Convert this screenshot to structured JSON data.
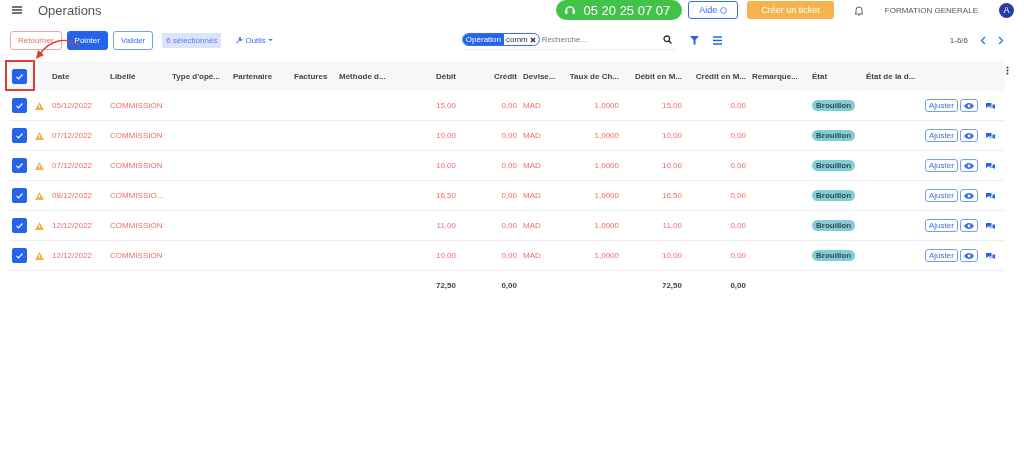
{
  "header": {
    "title": "Operations",
    "phone": "05 20 25 07 07",
    "help": "Aide",
    "ticket": "Créer un ticket",
    "company": "FORMATION GENERALE",
    "avatar": "A"
  },
  "toolbar": {
    "buttons": [
      {
        "label": "Retourner",
        "kind": "danger"
      },
      {
        "label": "Pointer",
        "kind": "primary"
      },
      {
        "label": "Valider",
        "kind": "outline"
      }
    ],
    "selection": "6 sélectionnés",
    "tools": "Outils"
  },
  "search": {
    "facet_label": "Opération",
    "facet_value": "comm",
    "placeholder": "Recherche..."
  },
  "pager": "1-6/6",
  "table": {
    "all_checked": true,
    "columns": [
      "Date",
      "Libellé",
      "Type d'opé...",
      "Partenaire",
      "Factures",
      "Méthode d...",
      "Débit",
      "Crédit",
      "Devise...",
      "Taux de Ch...",
      "Débit en M...",
      "Crédit en M...",
      "Remarque...",
      "État",
      "État de la d..."
    ],
    "rows": [
      {
        "selected": true,
        "warning": true,
        "date": "05/12/2022",
        "label": "COMMISSION",
        "debit": "15,00",
        "credit": "0,00",
        "currency": "MAD",
        "rate": "1,0000",
        "debit_mad": "15,00",
        "credit_mad": "0,00",
        "state": "Brouillon",
        "action": "Ajuster"
      },
      {
        "selected": true,
        "warning": true,
        "date": "07/12/2022",
        "label": "COMMISSION",
        "debit": "10,00",
        "credit": "0,00",
        "currency": "MAD",
        "rate": "1,0000",
        "debit_mad": "10,00",
        "credit_mad": "0,00",
        "state": "Brouillon",
        "action": "Ajuster"
      },
      {
        "selected": true,
        "warning": true,
        "date": "07/12/2022",
        "label": "COMMISSION",
        "debit": "10,00",
        "credit": "0,00",
        "currency": "MAD",
        "rate": "1,0000",
        "debit_mad": "10,00",
        "credit_mad": "0,00",
        "state": "Brouillon",
        "action": "Ajuster"
      },
      {
        "selected": true,
        "warning": true,
        "date": "08/12/2022",
        "label": "COMMISSIO...",
        "debit": "16,50",
        "credit": "0,00",
        "currency": "MAD",
        "rate": "1,0000",
        "debit_mad": "16,50",
        "credit_mad": "0,00",
        "state": "Brouillon",
        "action": "Ajuster"
      },
      {
        "selected": true,
        "warning": true,
        "date": "12/12/2022",
        "label": "COMMISSION",
        "debit": "11,00",
        "credit": "0,00",
        "currency": "MAD",
        "rate": "1,0000",
        "debit_mad": "11,00",
        "credit_mad": "0,00",
        "state": "Brouillon",
        "action": "Ajuster"
      },
      {
        "selected": true,
        "warning": true,
        "date": "12/12/2022",
        "label": "COMMISSION",
        "debit": "10,00",
        "credit": "0,00",
        "currency": "MAD",
        "rate": "1,0000",
        "debit_mad": "10,00",
        "credit_mad": "0,00",
        "state": "Brouillon",
        "action": "Ajuster"
      }
    ],
    "totals": {
      "debit": "72,50",
      "credit": "0,00",
      "debit_mad": "72,50",
      "credit_mad": "0,00"
    }
  }
}
